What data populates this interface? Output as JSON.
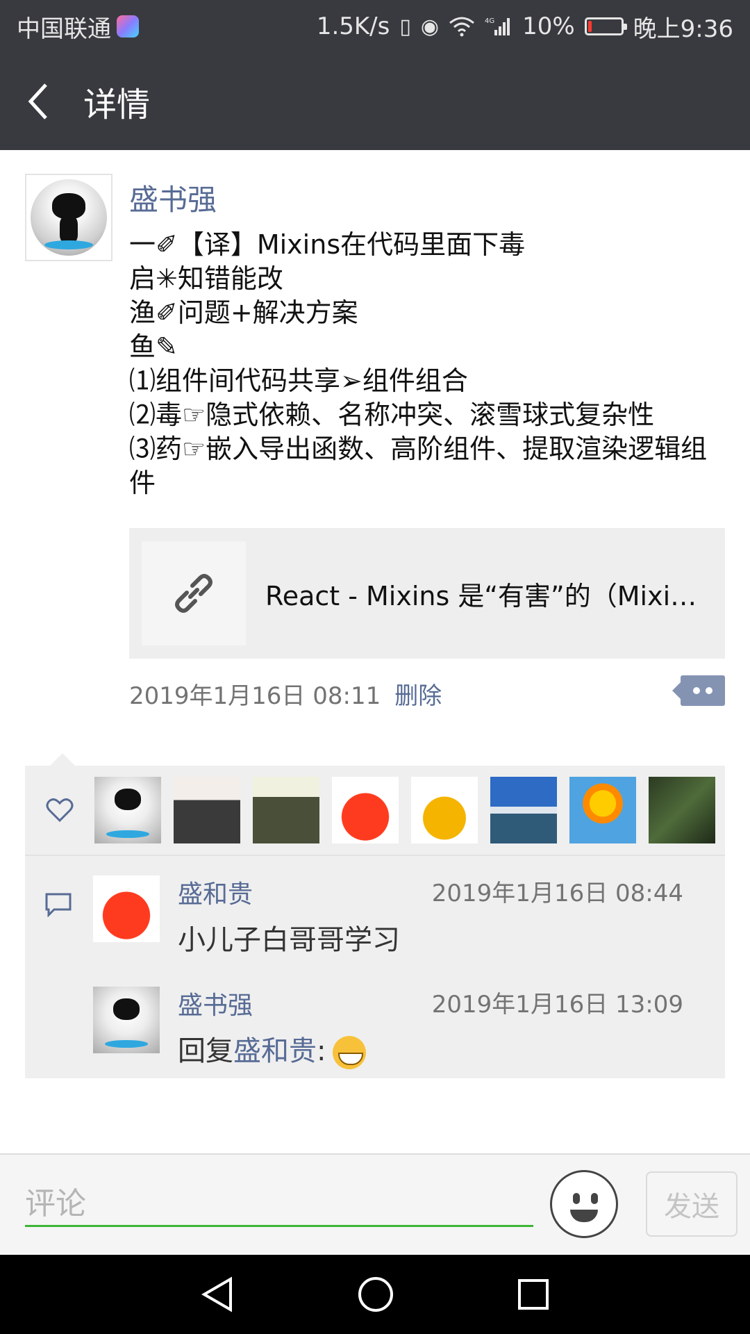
{
  "status_bar": {
    "carrier": "中国联通",
    "speed": "1.5K/s",
    "battery_percent": "10%",
    "battery_level": 0.1,
    "time": "晚上9:36",
    "icons": [
      "vibrate-icon",
      "eye-icon",
      "wifi-icon",
      "signal-4g-icon",
      "battery-icon"
    ]
  },
  "nav": {
    "title": "详情"
  },
  "post": {
    "author": "盛书强",
    "text": "一✐【译】Mixins在代码里面下毒\n启✳知错能改\n渔✐问题+解决方案\n鱼✎\n⑴组件间代码共享➢组件组合\n⑵毒☞隐式依赖、名称冲突、滚雪球式复杂性\n⑶药☞嵌入导出函数、高阶组件、提取渲染逻辑组件",
    "link_title": "React - Mixins 是“有害”的（Mixins Considered Harmful）",
    "timestamp": "2019年1月16日 08:11",
    "delete_label": "删除"
  },
  "likes": {
    "avatars": [
      "av-cat",
      "av-man",
      "av-glasses",
      "av-apple",
      "av-gourd",
      "av-lake",
      "av-sun",
      "av-plant"
    ]
  },
  "comments": [
    {
      "name": "盛和贵",
      "time": "2019年1月16日 08:44",
      "text": "小儿子白哥哥学习",
      "avatar": "av-apple"
    },
    {
      "name": "盛书强",
      "time": "2019年1月16日 13:09",
      "reply_prefix": "回复",
      "reply_to": "盛和贵",
      "reply_suffix": ":",
      "avatar": "av-cat"
    }
  ],
  "input": {
    "placeholder": "评论",
    "send_label": "发送"
  },
  "colors": {
    "header_bg": "#393a3f",
    "link_blue": "#576b95",
    "input_green": "#3fb435"
  }
}
